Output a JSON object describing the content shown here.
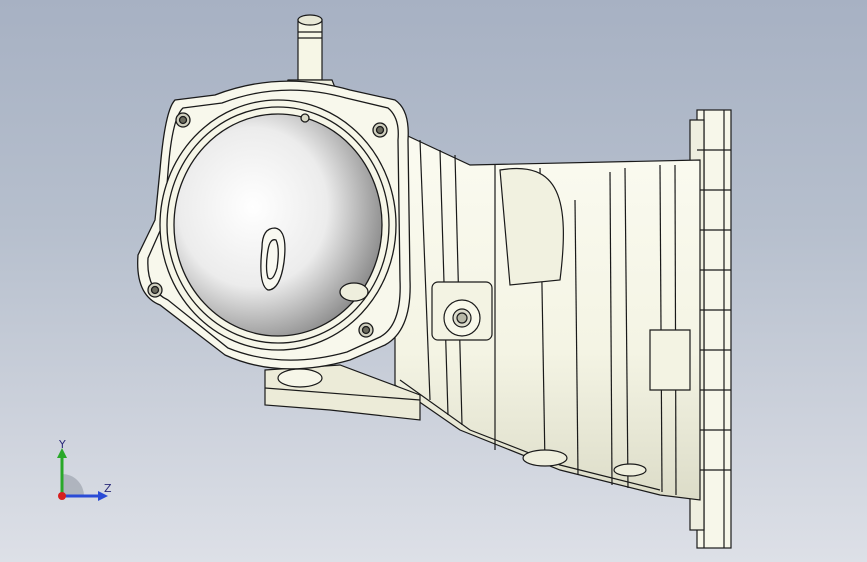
{
  "viewport": {
    "background_top": "#a7b1c3",
    "background_bottom": "#dde0e7"
  },
  "model": {
    "body_color": "#f8f8ea",
    "edge_color": "#1a1a1a",
    "shade_color": "#d9d9c4"
  },
  "triad": {
    "y_label": "Y",
    "z_label": "Z",
    "y_color": "#29a829",
    "z_color": "#2a4bd6",
    "origin_color": "#d61f1f"
  }
}
